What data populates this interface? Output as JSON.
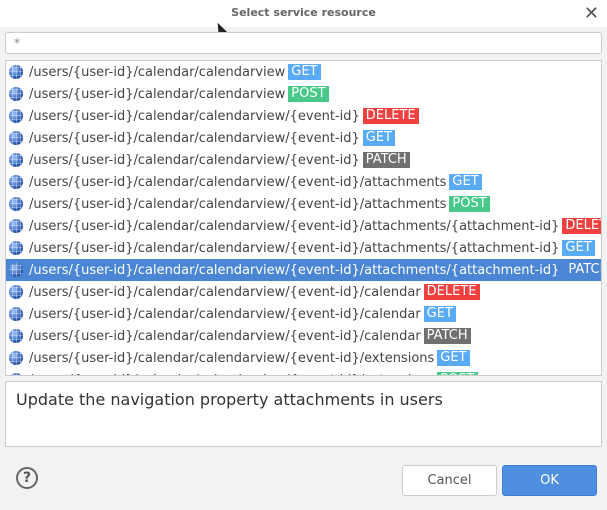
{
  "dialog": {
    "title": "Select service resource"
  },
  "search": {
    "value": "*"
  },
  "colors": {
    "GET": "#5aabf5",
    "POST": "#48c98a",
    "DELETE": "#f04040",
    "PATCH": "#707070",
    "selected": "#4a86d4"
  },
  "items": [
    {
      "path": "/users/{user-id}/calendar/calendarview",
      "method": "GET"
    },
    {
      "path": "/users/{user-id}/calendar/calendarview",
      "method": "POST"
    },
    {
      "path": "/users/{user-id}/calendar/calendarview/{event-id}",
      "method": "DELETE"
    },
    {
      "path": "/users/{user-id}/calendar/calendarview/{event-id}",
      "method": "GET"
    },
    {
      "path": "/users/{user-id}/calendar/calendarview/{event-id}",
      "method": "PATCH"
    },
    {
      "path": "/users/{user-id}/calendar/calendarview/{event-id}/attachments",
      "method": "GET"
    },
    {
      "path": "/users/{user-id}/calendar/calendarview/{event-id}/attachments",
      "method": "POST"
    },
    {
      "path": "/users/{user-id}/calendar/calendarview/{event-id}/attachments/{attachment-id}",
      "method": "DELETE"
    },
    {
      "path": "/users/{user-id}/calendar/calendarview/{event-id}/attachments/{attachment-id}",
      "method": "GET"
    },
    {
      "path": "/users/{user-id}/calendar/calendarview/{event-id}/attachments/{attachment-id}",
      "method": "PATCH",
      "selected": true
    },
    {
      "path": "/users/{user-id}/calendar/calendarview/{event-id}/calendar",
      "method": "DELETE"
    },
    {
      "path": "/users/{user-id}/calendar/calendarview/{event-id}/calendar",
      "method": "GET"
    },
    {
      "path": "/users/{user-id}/calendar/calendarview/{event-id}/calendar",
      "method": "PATCH"
    },
    {
      "path": "/users/{user-id}/calendar/calendarview/{event-id}/extensions",
      "method": "GET"
    },
    {
      "path": "/users/{user-id}/calendar/calendarview/{event-id}/extensions",
      "method": "POST"
    }
  ],
  "description": "Update the navigation property attachments in users",
  "buttons": {
    "help": "?",
    "cancel": "Cancel",
    "ok": "OK"
  }
}
